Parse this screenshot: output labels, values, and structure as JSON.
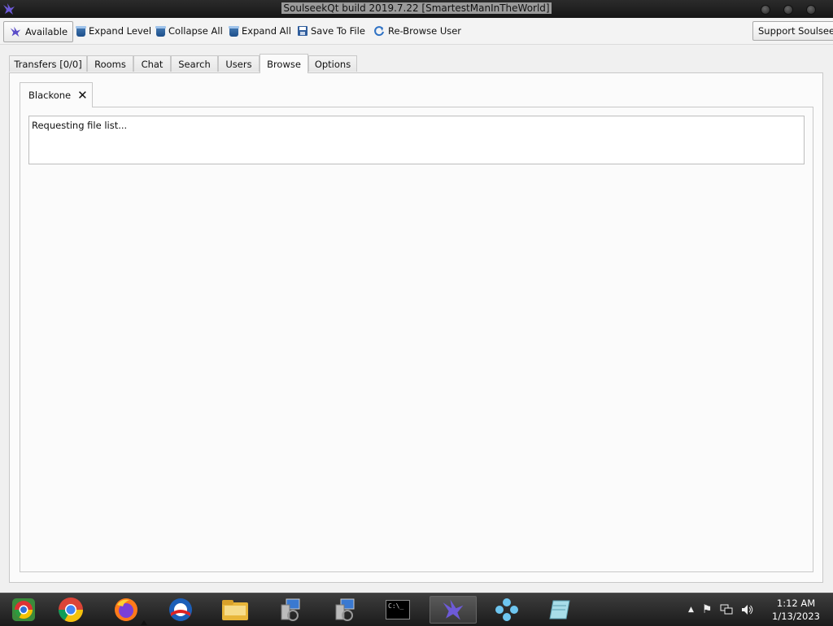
{
  "window": {
    "title": "SoulseekQt build 2019.7.22 [SmartestManInTheWorld]"
  },
  "toolbar": {
    "status_label": "Available",
    "expand_level_label": "Expand Level",
    "collapse_all_label": "Collapse All",
    "expand_all_label": "Expand All",
    "save_to_file_label": "Save To File",
    "rebrowse_label": "Re-Browse User",
    "support_label": "Support Soulseek!"
  },
  "tabs": [
    {
      "label": "Transfers [0/0]"
    },
    {
      "label": "Rooms"
    },
    {
      "label": "Chat"
    },
    {
      "label": "Search"
    },
    {
      "label": "Users"
    },
    {
      "label": "Browse",
      "active": true
    },
    {
      "label": "Options"
    }
  ],
  "browse": {
    "user_tab_label": "Blackone",
    "status_text": "Requesting file list..."
  },
  "taskbar": {
    "apps": [
      {
        "name": "chromium-icon"
      },
      {
        "name": "chrome-icon"
      },
      {
        "name": "firefox-icon"
      },
      {
        "name": "obama-app-icon"
      },
      {
        "name": "file-explorer-icon"
      },
      {
        "name": "network-setup-icon"
      },
      {
        "name": "network-setup-icon-2"
      },
      {
        "name": "command-prompt-icon",
        "text": "C:\\_"
      },
      {
        "name": "soulseek-icon",
        "active": true
      },
      {
        "name": "ppsspp-icon"
      },
      {
        "name": "notepad-icon"
      }
    ],
    "clock_time": "1:12 AM",
    "clock_date": "1/13/2023"
  },
  "colors": {
    "accent_blue": "#1d4f8a",
    "taskbar_bg": "#1b1b1b",
    "titlebar_bg": "#161616"
  }
}
